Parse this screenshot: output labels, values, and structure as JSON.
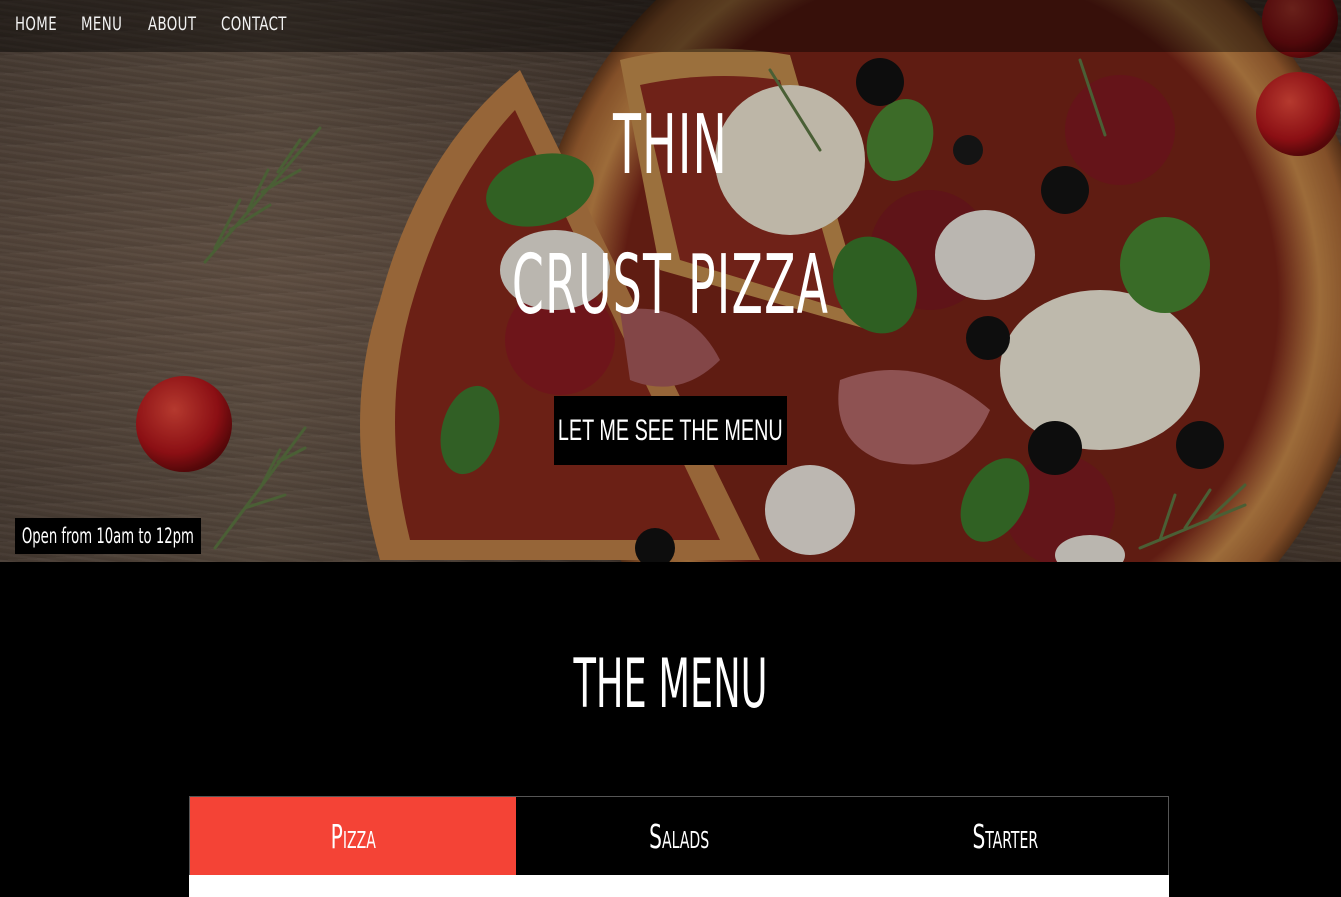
{
  "nav": {
    "items": [
      {
        "label": "HOME"
      },
      {
        "label": "MENU"
      },
      {
        "label": "ABOUT"
      },
      {
        "label": "CONTACT"
      }
    ]
  },
  "hero": {
    "title_line1": "THIN",
    "title_line2": "CRUST PIZZA",
    "cta_label": "LET ME SEE THE MENU",
    "hours": "Open from 10am to 12pm"
  },
  "menu": {
    "heading": "THE MENU",
    "tabs": [
      {
        "label": "Pizza",
        "active": true
      },
      {
        "label": "Salads",
        "active": false
      },
      {
        "label": "Starter",
        "active": false
      }
    ]
  },
  "colors": {
    "accent": "#f44336",
    "background": "#000000",
    "text": "#ffffff"
  }
}
